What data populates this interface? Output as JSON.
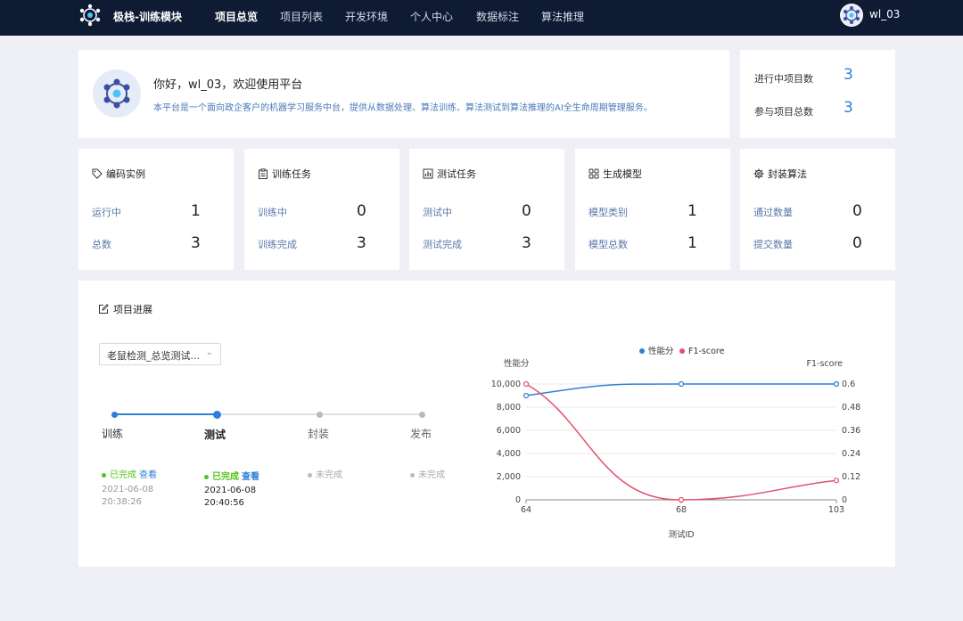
{
  "nav": {
    "brand": "极栈-训练模块",
    "items": [
      {
        "label": "项目总览",
        "active": true
      },
      {
        "label": "项目列表",
        "active": false
      },
      {
        "label": "开发环境",
        "active": false
      },
      {
        "label": "个人中心",
        "active": false
      },
      {
        "label": "数据标注",
        "active": false
      },
      {
        "label": "算法推理",
        "active": false
      }
    ],
    "username": "wl_03"
  },
  "welcome": {
    "title": "你好，wl_03，欢迎使用平台",
    "description": "本平台是一个面向政企客户的机器学习服务中台，提供从数据处理、算法训练、算法测试到算法推理的AI全生命周期管理服务。"
  },
  "projects": {
    "in_progress_label": "进行中项目数",
    "in_progress_value": "3",
    "participating_label": "参与项目总数",
    "participating_value": "3"
  },
  "stats": [
    {
      "title": "编码实例",
      "icon": "tag-icon",
      "rows": [
        {
          "label": "运行中",
          "value": "1"
        },
        {
          "label": "总数",
          "value": "3"
        }
      ]
    },
    {
      "title": "训练任务",
      "icon": "clipboard-icon",
      "rows": [
        {
          "label": "训练中",
          "value": "0"
        },
        {
          "label": "训练完成",
          "value": "3"
        }
      ]
    },
    {
      "title": "测试任务",
      "icon": "bar-chart-icon",
      "rows": [
        {
          "label": "测试中",
          "value": "0"
        },
        {
          "label": "测试完成",
          "value": "3"
        }
      ]
    },
    {
      "title": "生成模型",
      "icon": "grid-icon",
      "rows": [
        {
          "label": "模型类别",
          "value": "1"
        },
        {
          "label": "模型总数",
          "value": "1"
        }
      ]
    },
    {
      "title": "封装算法",
      "icon": "gear-icon",
      "rows": [
        {
          "label": "通过数量",
          "value": "0"
        },
        {
          "label": "提交数量",
          "value": "0"
        }
      ]
    }
  ],
  "progress": {
    "title": "项目进展",
    "select_value": "老鼠检测_总览测试...",
    "steps": [
      {
        "name": "训练",
        "status": "已完成",
        "view": "查看",
        "date": "2021-06-08",
        "time": "20:38:26",
        "done": true
      },
      {
        "name": "测试",
        "status": "已完成",
        "view": "查看",
        "date": "2021-06-08",
        "time": "20:40:56",
        "done": true
      },
      {
        "name": "封装",
        "status": "未完成",
        "view": "",
        "date": "",
        "time": "",
        "done": false
      },
      {
        "name": "发布",
        "status": "未完成",
        "view": "",
        "date": "",
        "time": "",
        "done": false
      }
    ]
  },
  "colors": {
    "nav_bg": "#0f1a33",
    "accent": "#2f7fd8",
    "done_green": "#52c41a",
    "pending_gray": "#bbbbbb",
    "series_perf": "#2f7fd8",
    "series_f1": "#e0506e"
  },
  "chart_data": {
    "type": "line",
    "title": "",
    "xlabel": "测试ID",
    "ylabel": "性能分",
    "y2label": "F1-score",
    "categories": [
      "64",
      "68",
      "103"
    ],
    "ylim": [
      0,
      10000
    ],
    "y2lim": [
      0,
      0.6
    ],
    "yticks": [
      "0",
      "2,000",
      "4,000",
      "6,000",
      "8,000",
      "10,000"
    ],
    "y2ticks": [
      "0",
      "0.12",
      "0.24",
      "0.36",
      "0.48",
      "0.6"
    ],
    "legend_position": "top",
    "grid": true,
    "series": [
      {
        "name": "性能分",
        "axis": "left",
        "values": [
          9000,
          10000,
          10000
        ]
      },
      {
        "name": "F1-score",
        "axis": "right",
        "values": [
          0.6,
          0,
          0.1
        ]
      }
    ]
  }
}
